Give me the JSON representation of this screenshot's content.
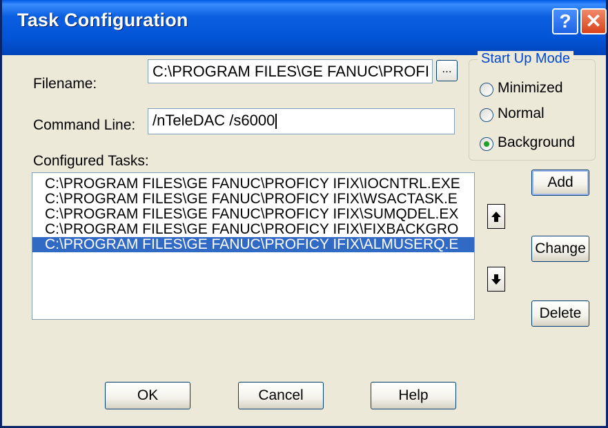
{
  "window": {
    "title": "Task Configuration",
    "help_glyph": "?",
    "close_glyph": "✕"
  },
  "filename": {
    "label": "Filename:",
    "value": "C:\\PROGRAM FILES\\GE FANUC\\PROFI",
    "browse_label": "..."
  },
  "command_line": {
    "label": "Command Line:",
    "value": "/nTeleDAC /s6000"
  },
  "startup_mode": {
    "title": "Start Up Mode",
    "options": [
      "Minimized",
      "Normal",
      "Background"
    ],
    "selected": "Background"
  },
  "configured_tasks": {
    "label": "Configured Tasks:",
    "items": [
      "C:\\PROGRAM FILES\\GE FANUC\\PROFICY IFIX\\IOCNTRL.EXE",
      "C:\\PROGRAM FILES\\GE FANUC\\PROFICY IFIX\\WSACTASK.E",
      "C:\\PROGRAM FILES\\GE FANUC\\PROFICY IFIX\\SUMQDEL.EX",
      "C:\\PROGRAM FILES\\GE FANUC\\PROFICY IFIX\\FIXBACKGRO",
      "C:\\PROGRAM FILES\\GE FANUC\\PROFICY IFIX\\ALMUSERQ.E"
    ],
    "selected_index": 4
  },
  "side_buttons": {
    "add": "Add",
    "change": "Change",
    "delete": "Delete"
  },
  "bottom_buttons": {
    "ok": "OK",
    "cancel": "Cancel",
    "help": "Help"
  },
  "colors": {
    "title_blue": "#0354d6",
    "selection": "#316ac5",
    "group_title": "#0046d5"
  }
}
